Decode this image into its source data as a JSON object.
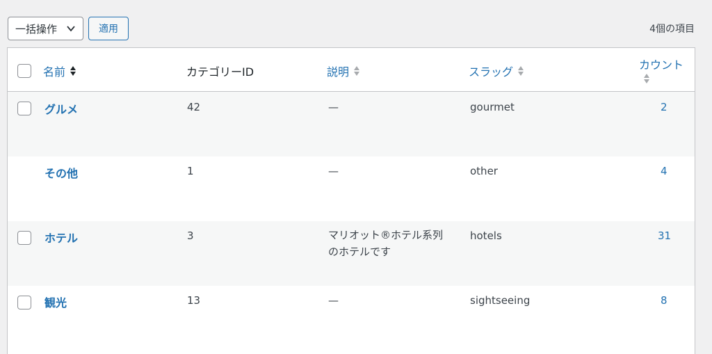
{
  "toolbar": {
    "bulk_action_label": "一括操作",
    "apply_label": "適用",
    "item_count": "4個の項目"
  },
  "table": {
    "headers": {
      "name": "名前",
      "category_id": "カテゴリーID",
      "description": "説明",
      "slug": "スラッグ",
      "count": "カウント"
    },
    "rows": [
      {
        "name": "グルメ",
        "id": "42",
        "description": "—",
        "slug": "gourmet",
        "count": "2",
        "has_checkbox": true
      },
      {
        "name": "その他",
        "id": "1",
        "description": "—",
        "slug": "other",
        "count": "4",
        "has_checkbox": false
      },
      {
        "name": "ホテル",
        "id": "3",
        "description_line1": "マリオット®ホテル系列",
        "description_line2": "のホテルです",
        "slug": "hotels",
        "count": "31",
        "has_checkbox": true
      },
      {
        "name": "観光",
        "id": "13",
        "description": "—",
        "slug": "sightseeing",
        "count": "8",
        "has_checkbox": true
      }
    ]
  },
  "colors": {
    "link": "#2271b1",
    "background": "#f0f0f1",
    "row_alt": "#f6f7f7"
  }
}
